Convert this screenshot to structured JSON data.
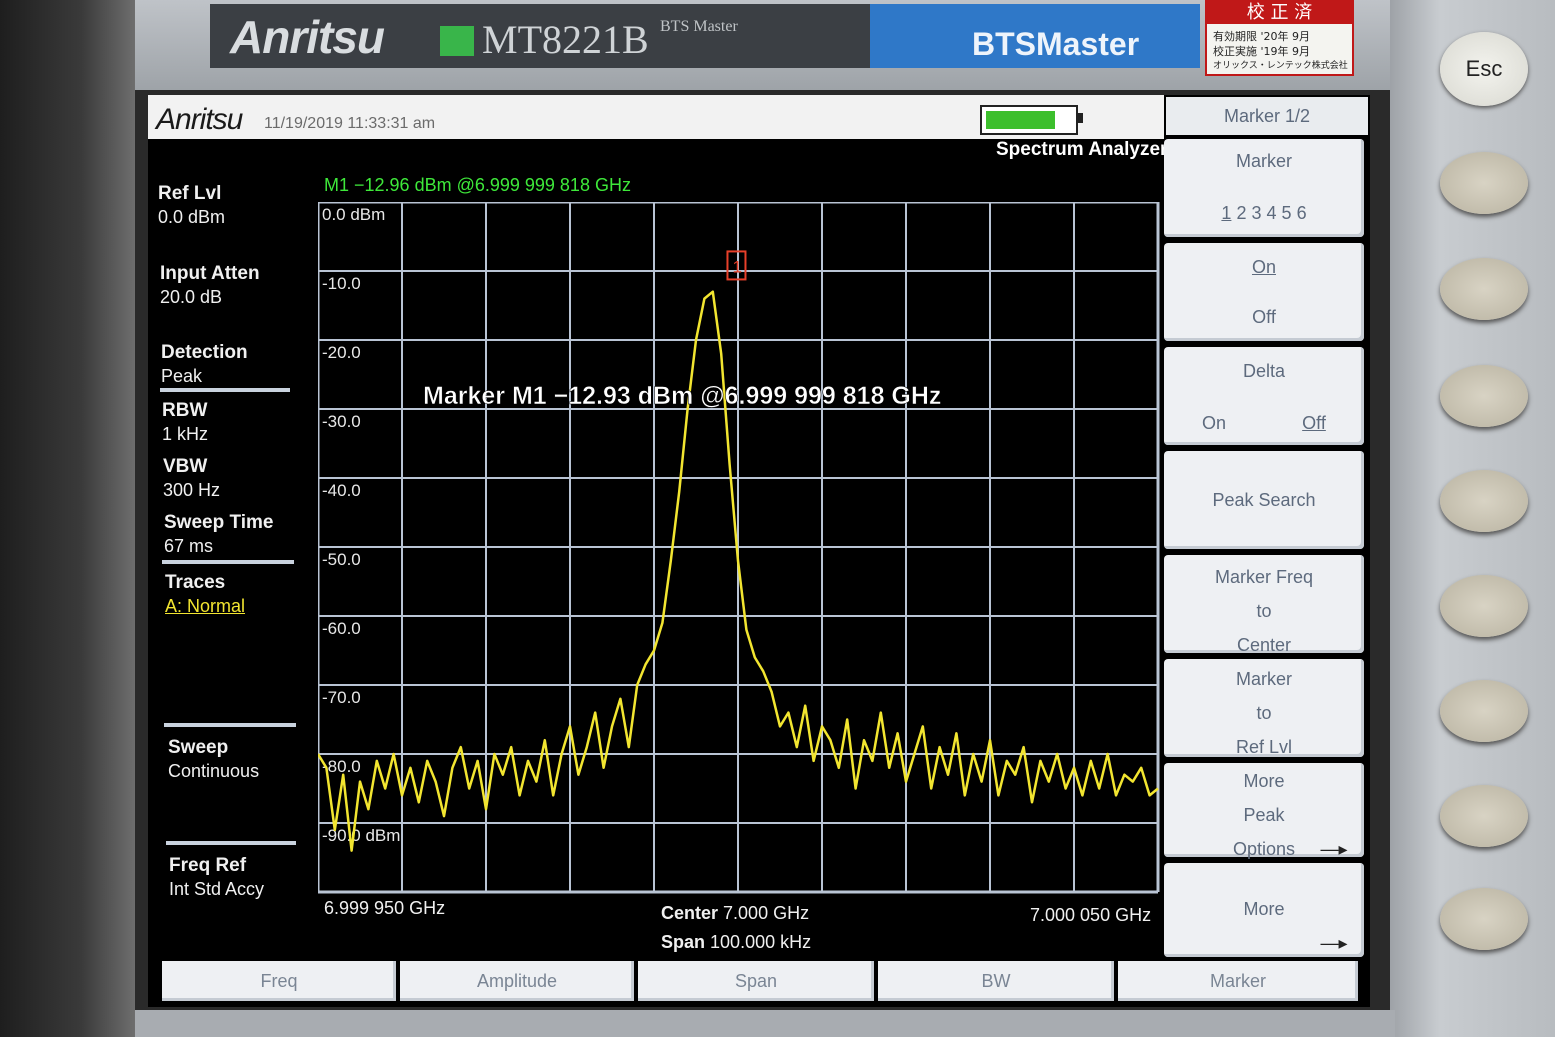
{
  "device": {
    "brand": "Anritsu",
    "model": "MT8221B",
    "model_subtitle": "BTS Master",
    "product_line": "BTSMaster",
    "calibration_sticker": {
      "title": "校 正 済",
      "line1": "有効期限 '20年 9月",
      "line2": "校正実施 '19年 9月",
      "line3": "オリックス・レンテック株式会社"
    },
    "esc_label": "Esc"
  },
  "screen": {
    "logo": "Anritsu",
    "datetime": "11/19/2019 11:33:31 am",
    "battery_level": 0.8,
    "mode": "Spectrum Analyzer"
  },
  "params": {
    "ref_lvl": {
      "label": "Ref Lvl",
      "value": "0.0 dBm"
    },
    "input_atten": {
      "label": "Input Atten",
      "value": "20.0 dB"
    },
    "detection": {
      "label": "Detection",
      "value": "Peak"
    },
    "rbw": {
      "label": "RBW",
      "value": "1 kHz"
    },
    "vbw": {
      "label": "VBW",
      "value": "300 Hz"
    },
    "sweep_time": {
      "label": "Sweep Time",
      "value": "67 ms"
    },
    "traces": {
      "label": "Traces",
      "value": "A: Normal"
    },
    "sweep": {
      "label": "Sweep",
      "value": "Continuous"
    },
    "freq_ref": {
      "label": "Freq Ref",
      "value": "Int Std Accy"
    }
  },
  "marker_readout": "M1 −12.96 dBm @6.999 999 818 GHz",
  "marker_annotation": "Marker M1 −12.93 dBm @6.999 999 818 GHz",
  "marker_flag": "1",
  "frequency": {
    "start": "6.999 950 GHz",
    "center_label": "Center",
    "center_value": "7.000 GHz",
    "span_label": "Span",
    "span_value": "100.000 kHz",
    "stop": "7.000 050 GHz"
  },
  "chart_data": {
    "type": "line",
    "x_unit": "GHz",
    "xlim": [
      6.99995,
      7.00005
    ],
    "ylim": [
      -100,
      0
    ],
    "y_tick_labels": [
      "0.0 dBm",
      "-10.0",
      "-20.0",
      "-30.0",
      "-40.0",
      "-50.0",
      "-60.0",
      "-70.0",
      "-80.0",
      "-90.0 dBm"
    ],
    "grid": true,
    "trace_color": "#f2e530",
    "grid_color": "#b9c4d4",
    "series": [
      {
        "x": [
          6.99995,
          6.999951,
          6.999952,
          6.999953,
          6.999954,
          6.999955,
          6.999956,
          6.999957,
          6.999958,
          6.999959,
          6.99996,
          6.999961,
          6.999962,
          6.999963,
          6.999964,
          6.999965,
          6.999966,
          6.999967,
          6.999968,
          6.999969,
          6.99997,
          6.999971,
          6.999972,
          6.999973,
          6.999974,
          6.999975,
          6.999976,
          6.999977,
          6.999978,
          6.999979,
          6.99998,
          6.999981,
          6.999982,
          6.999983,
          6.999984,
          6.999985,
          6.999986,
          6.999987,
          6.999988,
          6.999989,
          6.99999,
          6.999991,
          6.999992,
          6.999993,
          6.999994,
          6.999995,
          6.999996,
          6.999997,
          6.999998,
          6.999999,
          7.0,
          7.000001,
          7.000002,
          7.000003,
          7.000004,
          7.000005,
          7.000006,
          7.000007,
          7.000008,
          7.000009,
          7.00001,
          7.000011,
          7.000012,
          7.000013,
          7.000014,
          7.000015,
          7.000016,
          7.000017,
          7.000018,
          7.000019,
          7.00002,
          7.000021,
          7.000022,
          7.000023,
          7.000024,
          7.000025,
          7.000026,
          7.000027,
          7.000028,
          7.000029,
          7.00003,
          7.000031,
          7.000032,
          7.000033,
          7.000034,
          7.000035,
          7.000036,
          7.000037,
          7.000038,
          7.000039,
          7.00004,
          7.000041,
          7.000042,
          7.000043,
          7.000044,
          7.000045,
          7.000046,
          7.000047,
          7.000048,
          7.000049,
          7.00005
        ],
        "y": [
          -80,
          -82,
          -91,
          -83,
          -94,
          -84,
          -88,
          -81,
          -85,
          -80,
          -86,
          -82,
          -87,
          -81,
          -84,
          -89,
          -82,
          -79,
          -85,
          -81,
          -88,
          -80,
          -83,
          -79,
          -86,
          -81,
          -84,
          -78,
          -86,
          -80,
          -76,
          -83,
          -79,
          -74,
          -82,
          -76,
          -72,
          -79,
          -70,
          -67,
          -65,
          -61,
          -52,
          -42,
          -30,
          -20,
          -14,
          -13,
          -22,
          -38,
          -52,
          -62,
          -66,
          -68,
          -71,
          -76,
          -74,
          -79,
          -73,
          -81,
          -76,
          -78,
          -82,
          -75,
          -85,
          -78,
          -81,
          -74,
          -82,
          -77,
          -84,
          -80,
          -76,
          -85,
          -79,
          -83,
          -77,
          -86,
          -80,
          -84,
          -78,
          -86,
          -81,
          -83,
          -79,
          -87,
          -81,
          -84,
          -80,
          -85,
          -82,
          -86,
          -81,
          -85,
          -80,
          -86,
          -83,
          -84,
          -82,
          -86,
          -85
        ]
      }
    ],
    "marker": {
      "x": 6.999999818,
      "y": -12.96
    }
  },
  "softkeys": {
    "header": "Marker 1/2",
    "marker": {
      "line1": "Marker",
      "digits": [
        "1",
        "2",
        "3",
        "4",
        "5",
        "6"
      ]
    },
    "onoff": {
      "on": "On",
      "off": "Off"
    },
    "delta": {
      "title": "Delta",
      "on": "On",
      "off": "Off"
    },
    "peak_search": "Peak Search",
    "freq_to_center": {
      "l1": "Marker Freq",
      "l2": "to",
      "l3": "Center"
    },
    "to_ref_lvl": {
      "l1": "Marker",
      "l2": "to",
      "l3": "Ref Lvl"
    },
    "more_peak": {
      "l1": "More",
      "l2": "Peak",
      "l3": "Options",
      "arrow": "—▸"
    },
    "more": {
      "l1": "More",
      "arrow": "—▸"
    }
  },
  "bottom_keys": [
    "Freq",
    "Amplitude",
    "Span",
    "BW",
    "Marker"
  ]
}
